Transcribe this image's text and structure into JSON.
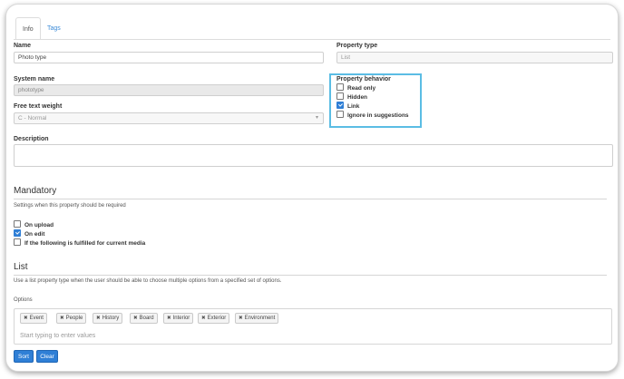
{
  "tabs": [
    {
      "label": "Info",
      "active": true
    },
    {
      "label": "Tags",
      "active": false
    }
  ],
  "name": {
    "label": "Name",
    "value": "Photo type"
  },
  "property_type": {
    "label": "Property type",
    "value": "List"
  },
  "system_name": {
    "label": "System name",
    "value": "phototype"
  },
  "free_text_weight": {
    "label": "Free text weight",
    "value": "C - Normal"
  },
  "property_behavior": {
    "label": "Property behavior",
    "options": [
      {
        "label": "Read only",
        "checked": false
      },
      {
        "label": "Hidden",
        "checked": false
      },
      {
        "label": "Link",
        "checked": true
      },
      {
        "label": "Ignore in suggestions",
        "checked": false
      }
    ]
  },
  "description": {
    "label": "Description",
    "value": ""
  },
  "mandatory": {
    "heading": "Mandatory",
    "help": "Settings when this property should be required",
    "options": [
      {
        "label": "On upload",
        "checked": false
      },
      {
        "label": "On edit",
        "checked": true
      },
      {
        "label": "If the following is fulfilled for current media",
        "checked": false
      }
    ]
  },
  "list": {
    "heading": "List",
    "help": "Use a list property type when the user should be able to choose multiple options from a specified set of options.",
    "options_label": "Options",
    "remove_glyph": "✖",
    "tags": [
      "Event",
      "People",
      "History",
      "Board",
      "Interior",
      "Exterior",
      "Environment"
    ],
    "placeholder": "Start typing to enter values"
  },
  "buttons": {
    "sort": "Sort",
    "clear": "Clear"
  },
  "colors": {
    "accent": "#2f7fd6",
    "highlight_border": "#5bbde4",
    "tab_link": "#3b8bd8"
  },
  "icons": {
    "checkbox": "checkbox-icon",
    "remove": "remove-x-icon",
    "dropdown": "chevron-down-icon"
  }
}
